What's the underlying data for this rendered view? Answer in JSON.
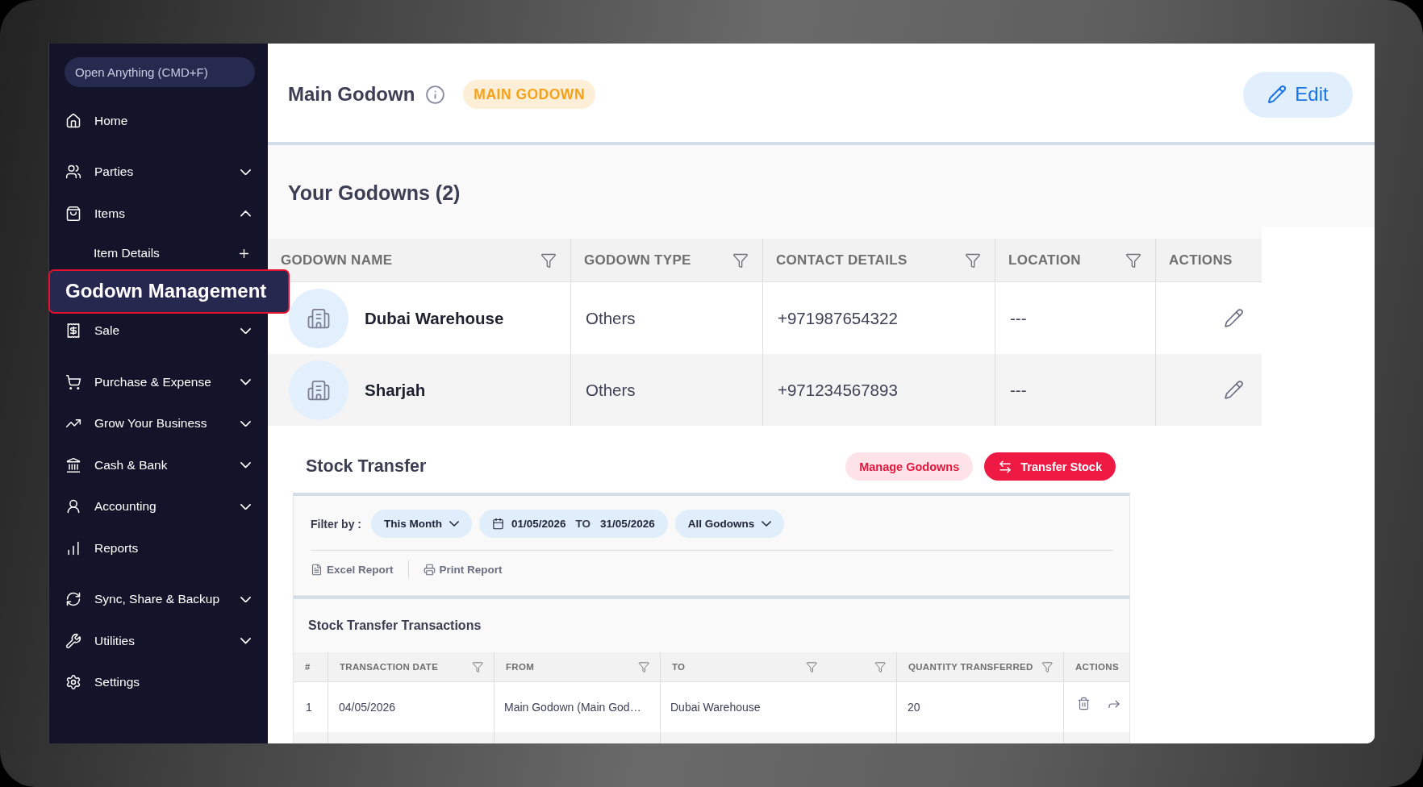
{
  "sidebar": {
    "search": {
      "placeholder": "Open Anything (CMD+F)"
    },
    "sections": [
      {
        "items": [
          {
            "label": "Home",
            "kind": "link",
            "selected": false
          }
        ]
      },
      {
        "items": [
          {
            "label": "Parties",
            "kind": "menu",
            "expanded": false,
            "selected": false
          },
          {
            "label": "Items",
            "kind": "menu",
            "expanded": true,
            "selected": false,
            "children": [
              {
                "label": "Item Details",
                "kind": "add",
                "selected": false
              },
              {
                "label": "Godown Management",
                "kind": "link",
                "selected": true
              }
            ]
          },
          {
            "label": "Sale",
            "kind": "menu",
            "expanded": false,
            "selected": false
          }
        ]
      },
      {
        "items": [
          {
            "label": "Purchase & Expense",
            "kind": "menu",
            "expanded": false,
            "selected": false
          },
          {
            "label": "Grow Your Business",
            "kind": "menu",
            "expanded": false,
            "selected": false
          },
          {
            "label": "Cash & Bank",
            "kind": "menu",
            "expanded": false,
            "selected": false
          },
          {
            "label": "Accounting",
            "kind": "menu",
            "expanded": false,
            "selected": false
          },
          {
            "label": "Reports",
            "kind": "link",
            "selected": false
          }
        ]
      },
      {
        "items": [
          {
            "label": "Sync, Share & Backup",
            "kind": "menu",
            "expanded": false,
            "selected": false
          },
          {
            "label": "Utilities",
            "kind": "menu",
            "expanded": false,
            "selected": false
          },
          {
            "label": "Settings",
            "kind": "link",
            "selected": false
          }
        ]
      }
    ]
  },
  "header": {
    "title": "Main Godown",
    "badge": "MAIN GODOWN",
    "edit_button": "Edit"
  },
  "godowns": {
    "title": "Your Godowns (2)",
    "columns": [
      {
        "label": "GODOWN NAME",
        "filterable": true
      },
      {
        "label": "GODOWN TYPE",
        "filterable": true
      },
      {
        "label": "CONTACT DETAILS",
        "filterable": true
      },
      {
        "label": "LOCATION",
        "filterable": true
      },
      {
        "label": "ACTIONS",
        "filterable": false
      }
    ],
    "rows": [
      {
        "name": "Dubai Warehouse",
        "type": "Others",
        "contact": "+971987654322",
        "location": "---"
      },
      {
        "name": "Sharjah",
        "type": "Others",
        "contact": "+971234567893",
        "location": "---"
      }
    ]
  },
  "stock_transfer": {
    "title": "Stock Transfer",
    "buttons": [
      {
        "kind": "secondary",
        "label": "Manage Godowns"
      },
      {
        "kind": "primary",
        "label": "Transfer Stock"
      }
    ],
    "filter": {
      "label": "Filter by :",
      "options": [
        {
          "kind": "dropdown",
          "label": "This Month"
        },
        {
          "kind": "date_range",
          "from": "01/05/2026",
          "separator": "TO",
          "to": "31/05/2026"
        },
        {
          "kind": "dropdown",
          "label": "All Godowns"
        }
      ]
    },
    "exports": [
      {
        "label": "Excel Report"
      },
      {
        "label": "Print Report"
      }
    ],
    "transactions": {
      "title": "Stock Transfer Transactions",
      "columns": [
        {
          "label": "#",
          "filterable": false
        },
        {
          "label": "TRANSACTION DATE",
          "filterable": true
        },
        {
          "label": "FROM",
          "filterable": true
        },
        {
          "label": "TO",
          "filterable": true
        },
        {
          "filterable": true
        },
        {
          "label": "QUANTITY TRANSFERRED",
          "filterable": true
        },
        {
          "label": "ACTIONS",
          "filterable": false
        }
      ],
      "rows": [
        {
          "index": "1",
          "date": "04/05/2026",
          "from": "Main Godown (Main God…",
          "to": "Dubai Warehouse",
          "quantity": "20"
        }
      ]
    }
  }
}
